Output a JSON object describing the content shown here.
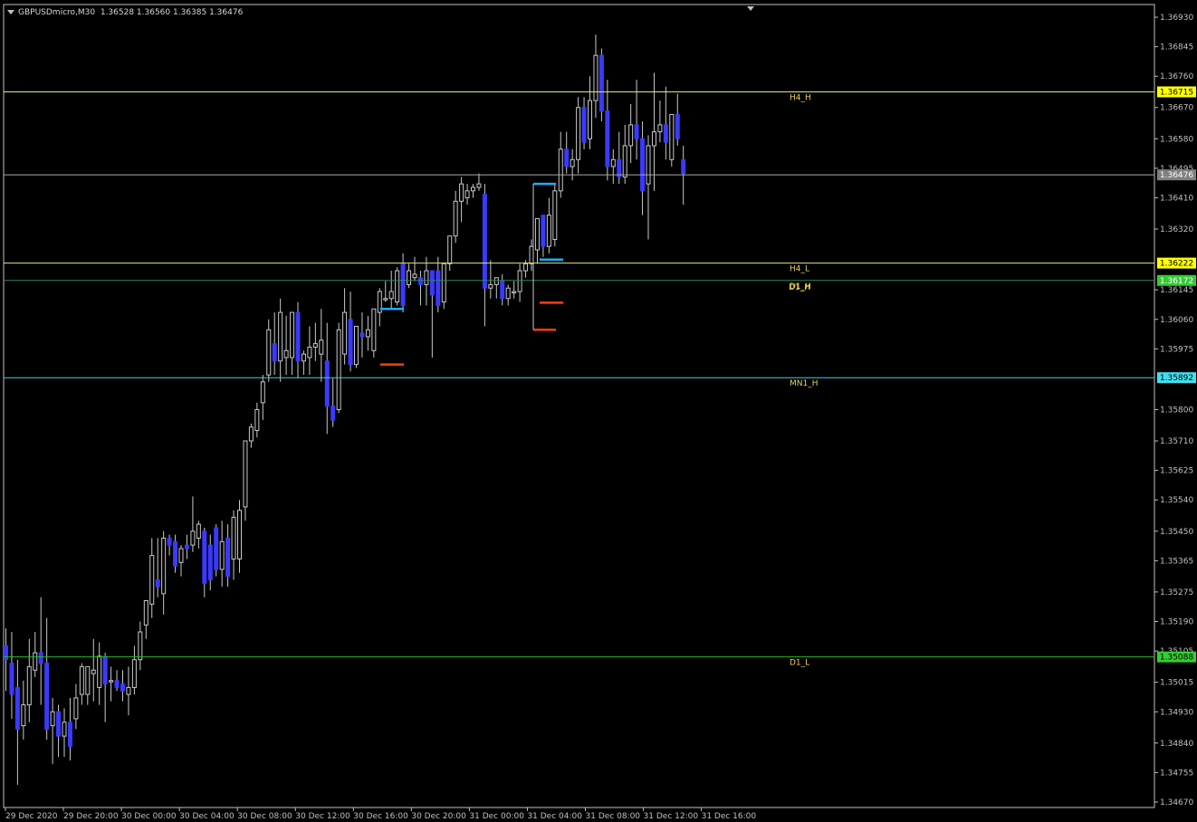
{
  "header": {
    "symbol_timeframe": "GBPUSDmicro,M30",
    "ohlc": "1.36528 1.36560 1.36385 1.36476"
  },
  "colors": {
    "background": "#000000",
    "axis": "#c0c0c0",
    "grid": "none",
    "candle_body": "#3a3aff",
    "candle_wick": "#c8c8c8",
    "bid_line": "#a8a8a8",
    "h4_line": "#e6e673",
    "d1_h_line": "#2e8b57",
    "d1_l_line": "#22c022",
    "mn1_line": "#4fc8d8",
    "level_label": "#e6d25a",
    "marker_blue": "#22aaff",
    "marker_red": "#ff3c14"
  },
  "chart_data": {
    "type": "candlestick",
    "ylim": [
      1.3467,
      1.3693
    ],
    "price_axis_ticks": [
      "1.36930",
      "1.36845",
      "1.36760",
      "1.36670",
      "1.36580",
      "1.36495",
      "1.36410",
      "1.36320",
      "1.36145",
      "1.36060",
      "1.35975",
      "1.35800",
      "1.35710",
      "1.35625",
      "1.35540",
      "1.35450",
      "1.35365",
      "1.35275",
      "1.35190",
      "1.35105",
      "1.35015",
      "1.34930",
      "1.34840",
      "1.34755",
      "1.34670"
    ],
    "time_axis_labels": [
      "29 Dec 2020",
      "29 Dec 20:00",
      "30 Dec 00:00",
      "30 Dec 04:00",
      "30 Dec 08:00",
      "30 Dec 12:00",
      "30 Dec 16:00",
      "30 Dec 20:00",
      "31 Dec 00:00",
      "31 Dec 04:00",
      "31 Dec 08:00",
      "31 Dec 12:00",
      "31 Dec 16:00"
    ],
    "levels": [
      {
        "name": "H4_H",
        "price": 1.36715,
        "price_label": "1.36715",
        "color_key": "h4_line",
        "badge_bg": "#ffff00",
        "badge_fg": "#000000"
      },
      {
        "name": "H4_L",
        "price": 1.36222,
        "price_label": "1.36222",
        "color_key": "h4_line",
        "badge_bg": "#ffff00",
        "badge_fg": "#000000"
      },
      {
        "name": "D1_H",
        "price": 1.36172,
        "price_label": "1.36172",
        "color_key": "d1_h_line",
        "badge_bg": "#32cd32",
        "badge_fg": "#ffffff"
      },
      {
        "name": "MN1_H",
        "price": 1.35892,
        "price_label": "1.35892",
        "color_key": "mn1_line",
        "badge_bg": "#40e0f0",
        "badge_fg": "#000000"
      },
      {
        "name": "D1_L",
        "price": 1.35088,
        "price_label": "1.35088",
        "color_key": "d1_l_line",
        "badge_bg": "#32cd32",
        "badge_fg": "#000000"
      }
    ],
    "bid": {
      "price": 1.36476,
      "label": "1.36476"
    },
    "candles": [
      {
        "o": 1.3512,
        "h": 1.3517,
        "c": 1.3508,
        "l": 1.3499
      },
      {
        "o": 1.3507,
        "h": 1.3516,
        "c": 1.3498,
        "l": 1.3491
      },
      {
        "o": 1.35,
        "h": 1.3508,
        "c": 1.3488,
        "l": 1.3472
      },
      {
        "o": 1.3489,
        "h": 1.3502,
        "c": 1.3495,
        "l": 1.3485
      },
      {
        "o": 1.3495,
        "h": 1.3514,
        "c": 1.3506,
        "l": 1.349
      },
      {
        "o": 1.3505,
        "h": 1.3516,
        "c": 1.351,
        "l": 1.3503
      },
      {
        "o": 1.351,
        "h": 1.3526,
        "c": 1.3507,
        "l": 1.3495
      },
      {
        "o": 1.3507,
        "h": 1.352,
        "c": 1.3488,
        "l": 1.3485
      },
      {
        "o": 1.3489,
        "h": 1.3497,
        "c": 1.3493,
        "l": 1.3478
      },
      {
        "o": 1.3493,
        "h": 1.3495,
        "c": 1.3486,
        "l": 1.348
      },
      {
        "o": 1.3486,
        "h": 1.3494,
        "c": 1.349,
        "l": 1.348
      },
      {
        "o": 1.349,
        "h": 1.3497,
        "c": 1.3483,
        "l": 1.3479
      },
      {
        "o": 1.3491,
        "h": 1.3501,
        "c": 1.3497,
        "l": 1.3488
      },
      {
        "o": 1.3498,
        "h": 1.3507,
        "c": 1.3506,
        "l": 1.3495
      },
      {
        "o": 1.3498,
        "h": 1.3504,
        "c": 1.3506,
        "l": 1.3495
      },
      {
        "o": 1.3504,
        "h": 1.3514,
        "c": 1.3505,
        "l": 1.3496
      },
      {
        "o": 1.35,
        "h": 1.3513,
        "c": 1.3509,
        "l": 1.3495
      },
      {
        "o": 1.3509,
        "h": 1.351,
        "c": 1.3501,
        "l": 1.349
      },
      {
        "o": 1.3502,
        "h": 1.3506,
        "c": 1.3502,
        "l": 1.3496
      },
      {
        "o": 1.3502,
        "h": 1.3505,
        "c": 1.35,
        "l": 1.3499
      },
      {
        "o": 1.3501,
        "h": 1.3505,
        "c": 1.3499,
        "l": 1.3496
      },
      {
        "o": 1.3498,
        "h": 1.3506,
        "c": 1.35,
        "l": 1.3492
      },
      {
        "o": 1.35,
        "h": 1.3512,
        "c": 1.3508,
        "l": 1.3498
      },
      {
        "o": 1.3508,
        "h": 1.3519,
        "c": 1.3516,
        "l": 1.3505
      },
      {
        "o": 1.3518,
        "h": 1.3525,
        "c": 1.3525,
        "l": 1.3514
      },
      {
        "o": 1.3524,
        "h": 1.3543,
        "c": 1.3538,
        "l": 1.352
      },
      {
        "o": 1.3531,
        "h": 1.3543,
        "c": 1.3529,
        "l": 1.3526
      },
      {
        "o": 1.3527,
        "h": 1.3545,
        "c": 1.3543,
        "l": 1.3521
      },
      {
        "o": 1.3543,
        "h": 1.3544,
        "c": 1.3541,
        "l": 1.3538
      },
      {
        "o": 1.3542,
        "h": 1.3544,
        "c": 1.3535,
        "l": 1.3533
      },
      {
        "o": 1.3536,
        "h": 1.3541,
        "c": 1.354,
        "l": 1.3532
      },
      {
        "o": 1.3541,
        "h": 1.3544,
        "c": 1.354,
        "l": 1.3537
      },
      {
        "o": 1.3541,
        "h": 1.3555,
        "c": 1.3545,
        "l": 1.3539
      },
      {
        "o": 1.3543,
        "h": 1.3548,
        "c": 1.3547,
        "l": 1.354
      },
      {
        "o": 1.3545,
        "h": 1.3546,
        "c": 1.353,
        "l": 1.3526
      },
      {
        "o": 1.3541,
        "h": 1.3544,
        "c": 1.3531,
        "l": 1.3528
      },
      {
        "o": 1.3546,
        "h": 1.3547,
        "c": 1.3534,
        "l": 1.3532
      },
      {
        "o": 1.3534,
        "h": 1.3548,
        "c": 1.3542,
        "l": 1.3529
      },
      {
        "o": 1.3543,
        "h": 1.3547,
        "c": 1.3532,
        "l": 1.3529
      },
      {
        "o": 1.3537,
        "h": 1.3551,
        "c": 1.3549,
        "l": 1.3531
      },
      {
        "o": 1.3537,
        "h": 1.3554,
        "c": 1.3551,
        "l": 1.3533
      },
      {
        "o": 1.3552,
        "h": 1.3568,
        "c": 1.3571,
        "l": 1.3548
      },
      {
        "o": 1.3571,
        "h": 1.3576,
        "c": 1.3575,
        "l": 1.3569
      },
      {
        "o": 1.3574,
        "h": 1.3582,
        "c": 1.358,
        "l": 1.3572
      },
      {
        "o": 1.3582,
        "h": 1.359,
        "c": 1.3588,
        "l": 1.3577
      },
      {
        "o": 1.359,
        "h": 1.3606,
        "c": 1.3603,
        "l": 1.3588
      },
      {
        "o": 1.3599,
        "h": 1.3608,
        "c": 1.3594,
        "l": 1.359
      },
      {
        "o": 1.3594,
        "h": 1.3612,
        "c": 1.3608,
        "l": 1.3588
      },
      {
        "o": 1.3595,
        "h": 1.3607,
        "c": 1.3597,
        "l": 1.359
      },
      {
        "o": 1.3595,
        "h": 1.3606,
        "c": 1.3608,
        "l": 1.359
      },
      {
        "o": 1.3608,
        "h": 1.3611,
        "c": 1.3594,
        "l": 1.3589
      },
      {
        "o": 1.3594,
        "h": 1.3597,
        "c": 1.3596,
        "l": 1.359
      },
      {
        "o": 1.3595,
        "h": 1.3604,
        "c": 1.3598,
        "l": 1.359
      },
      {
        "o": 1.3598,
        "h": 1.3605,
        "c": 1.3599,
        "l": 1.3594
      },
      {
        "o": 1.3596,
        "h": 1.3609,
        "c": 1.36,
        "l": 1.3588
      },
      {
        "o": 1.3594,
        "h": 1.3605,
        "c": 1.3581,
        "l": 1.3573
      },
      {
        "o": 1.3581,
        "h": 1.3589,
        "c": 1.3577,
        "l": 1.3575
      },
      {
        "o": 1.358,
        "h": 1.3605,
        "c": 1.3603,
        "l": 1.3579
      },
      {
        "o": 1.3596,
        "h": 1.3615,
        "c": 1.3608,
        "l": 1.3593
      },
      {
        "o": 1.3606,
        "h": 1.3614,
        "c": 1.3593,
        "l": 1.3591
      },
      {
        "o": 1.3593,
        "h": 1.3603,
        "c": 1.3604,
        "l": 1.3592
      },
      {
        "o": 1.3602,
        "h": 1.3608,
        "c": 1.3601,
        "l": 1.3595
      },
      {
        "o": 1.3601,
        "h": 1.3607,
        "c": 1.3603,
        "l": 1.3597
      },
      {
        "o": 1.3597,
        "h": 1.3606,
        "c": 1.3609,
        "l": 1.3595
      },
      {
        "o": 1.3608,
        "h": 1.3615,
        "c": 1.3614,
        "l": 1.3604
      },
      {
        "o": 1.3612,
        "h": 1.3617,
        "c": 1.3612,
        "l": 1.3611
      },
      {
        "o": 1.3612,
        "h": 1.362,
        "c": 1.3614,
        "l": 1.3609
      },
      {
        "o": 1.3611,
        "h": 1.3621,
        "c": 1.362,
        "l": 1.361
      },
      {
        "o": 1.3622,
        "h": 1.3625,
        "c": 1.361,
        "l": 1.3608
      },
      {
        "o": 1.3616,
        "h": 1.3622,
        "c": 1.362,
        "l": 1.3615
      },
      {
        "o": 1.3618,
        "h": 1.3624,
        "c": 1.3619,
        "l": 1.3617
      },
      {
        "o": 1.3618,
        "h": 1.362,
        "c": 1.3616,
        "l": 1.361
      },
      {
        "o": 1.3616,
        "h": 1.3624,
        "c": 1.362,
        "l": 1.361
      },
      {
        "o": 1.362,
        "h": 1.362,
        "c": 1.3613,
        "l": 1.3595
      },
      {
        "o": 1.362,
        "h": 1.3624,
        "c": 1.361,
        "l": 1.3608
      },
      {
        "o": 1.3611,
        "h": 1.3621,
        "c": 1.3622,
        "l": 1.3609
      },
      {
        "o": 1.3622,
        "h": 1.363,
        "c": 1.363,
        "l": 1.362
      },
      {
        "o": 1.363,
        "h": 1.3643,
        "c": 1.364,
        "l": 1.3628
      },
      {
        "o": 1.364,
        "h": 1.3647,
        "c": 1.3645,
        "l": 1.3634
      },
      {
        "o": 1.3641,
        "h": 1.3645,
        "c": 1.3643,
        "l": 1.3639
      },
      {
        "o": 1.3643,
        "h": 1.3645,
        "c": 1.3644,
        "l": 1.3641
      },
      {
        "o": 1.3644,
        "h": 1.3648,
        "c": 1.3645,
        "l": 1.3643
      },
      {
        "o": 1.3642,
        "h": 1.3645,
        "c": 1.3615,
        "l": 1.3604
      },
      {
        "o": 1.3615,
        "h": 1.3623,
        "c": 1.3616,
        "l": 1.3612
      },
      {
        "o": 1.3616,
        "h": 1.3618,
        "c": 1.3618,
        "l": 1.3612
      },
      {
        "o": 1.3617,
        "h": 1.3619,
        "c": 1.3612,
        "l": 1.361
      },
      {
        "o": 1.3612,
        "h": 1.3616,
        "c": 1.3615,
        "l": 1.361
      },
      {
        "o": 1.3614,
        "h": 1.3617,
        "c": 1.3614,
        "l": 1.3612
      },
      {
        "o": 1.3614,
        "h": 1.3622,
        "c": 1.362,
        "l": 1.3611
      },
      {
        "o": 1.362,
        "h": 1.3623,
        "c": 1.3622,
        "l": 1.3618
      },
      {
        "o": 1.3622,
        "h": 1.3629,
        "c": 1.3627,
        "l": 1.362
      },
      {
        "o": 1.3626,
        "h": 1.3635,
        "c": 1.3635,
        "l": 1.3622
      },
      {
        "o": 1.3636,
        "h": 1.3636,
        "c": 1.3627,
        "l": 1.3624
      },
      {
        "o": 1.3627,
        "h": 1.3641,
        "c": 1.3636,
        "l": 1.3625
      },
      {
        "o": 1.3629,
        "h": 1.3645,
        "c": 1.3643,
        "l": 1.3627
      },
      {
        "o": 1.3643,
        "h": 1.366,
        "c": 1.3655,
        "l": 1.3641
      },
      {
        "o": 1.3655,
        "h": 1.366,
        "c": 1.365,
        "l": 1.3648
      },
      {
        "o": 1.365,
        "h": 1.3655,
        "c": 1.3652,
        "l": 1.3646
      },
      {
        "o": 1.3652,
        "h": 1.367,
        "c": 1.3667,
        "l": 1.3648
      },
      {
        "o": 1.3667,
        "h": 1.367,
        "c": 1.3657,
        "l": 1.3655
      },
      {
        "o": 1.3658,
        "h": 1.3676,
        "c": 1.3669,
        "l": 1.3655
      },
      {
        "o": 1.3669,
        "h": 1.3688,
        "c": 1.3682,
        "l": 1.3664
      },
      {
        "o": 1.3682,
        "h": 1.3684,
        "c": 1.3666,
        "l": 1.3663
      },
      {
        "o": 1.3666,
        "h": 1.3675,
        "c": 1.365,
        "l": 1.3646
      },
      {
        "o": 1.365,
        "h": 1.3655,
        "c": 1.3652,
        "l": 1.3645
      },
      {
        "o": 1.3652,
        "h": 1.366,
        "c": 1.3647,
        "l": 1.3645
      },
      {
        "o": 1.3647,
        "h": 1.3662,
        "c": 1.3656,
        "l": 1.3645
      },
      {
        "o": 1.3656,
        "h": 1.3668,
        "c": 1.3662,
        "l": 1.3651
      },
      {
        "o": 1.3662,
        "h": 1.3675,
        "c": 1.3658,
        "l": 1.3652
      },
      {
        "o": 1.3658,
        "h": 1.3663,
        "c": 1.3643,
        "l": 1.3636
      },
      {
        "o": 1.3645,
        "h": 1.3659,
        "c": 1.3656,
        "l": 1.3629
      },
      {
        "o": 1.3656,
        "h": 1.3677,
        "c": 1.366,
        "l": 1.3643
      },
      {
        "o": 1.366,
        "h": 1.3669,
        "c": 1.3662,
        "l": 1.3657
      },
      {
        "o": 1.3662,
        "h": 1.3673,
        "c": 1.3657,
        "l": 1.3652
      },
      {
        "o": 1.3652,
        "h": 1.3664,
        "c": 1.3665,
        "l": 1.365
      },
      {
        "o": 1.3665,
        "h": 1.3671,
        "c": 1.3658,
        "l": 1.3656
      },
      {
        "o": 1.3652,
        "h": 1.3656,
        "c": 1.3648,
        "l": 1.3639
      }
    ]
  }
}
